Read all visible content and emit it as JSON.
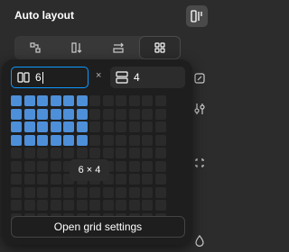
{
  "panel": {
    "title": "Auto layout"
  },
  "direction_options": [
    {
      "icon": "wrap-icon",
      "active": false
    },
    {
      "icon": "vertical-direction-icon",
      "active": false
    },
    {
      "icon": "horizontal-direction-icon",
      "active": false
    },
    {
      "icon": "grid-icon",
      "active": true
    }
  ],
  "grid_picker": {
    "columns_value": "6",
    "rows_value": "4",
    "times_symbol": "×",
    "total_columns": 12,
    "total_rows": 10,
    "selected_columns": 6,
    "selected_rows": 4,
    "tooltip": "6 × 4",
    "open_settings_label": "Open grid settings"
  },
  "colors": {
    "accent": "#0d99ff",
    "selected_cell": "#4d8fd9",
    "empty_cell": "#2a2a2a",
    "popover_bg": "#1e1e1e",
    "panel_bg": "#2c2c2c"
  }
}
